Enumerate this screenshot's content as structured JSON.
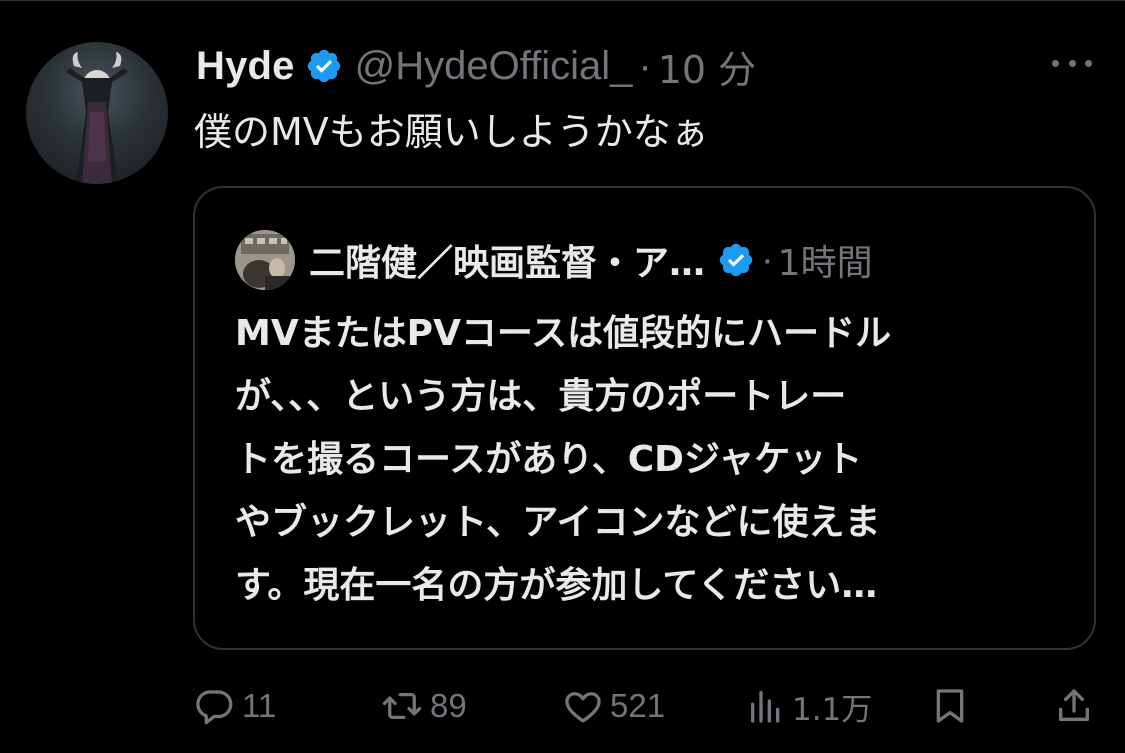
{
  "tweet": {
    "author": {
      "display_name": "Hyde",
      "handle": "@HydeOfficial_",
      "verified": true,
      "verified_color": "#1d9bf0"
    },
    "separator": "·",
    "time": "10 分",
    "text": "僕のMVもお願いしようかなぁ",
    "more_icon": "more-horizontal-icon"
  },
  "quoted_tweet": {
    "author": {
      "display_name": "二階健／映画監督・ア…",
      "verified": true
    },
    "separator": "·",
    "time": "1時間",
    "text_lines": [
      "MVまたはPVコースは値段的にハードル",
      "が、、、という方は、貴方のポートレー",
      "トを撮るコースがあり、CDジャケット",
      "やブックレット、アイコンなどに使えま",
      "す。現在一名の方が参加してください…"
    ]
  },
  "actions": {
    "reply": {
      "icon": "reply-icon",
      "count": "11"
    },
    "retweet": {
      "icon": "retweet-icon",
      "count": "89"
    },
    "like": {
      "icon": "heart-icon",
      "count": "521"
    },
    "views": {
      "icon": "views-icon",
      "count": "1.1万"
    },
    "bookmark": {
      "icon": "bookmark-icon"
    },
    "share": {
      "icon": "share-icon"
    }
  },
  "colors": {
    "background": "#000000",
    "text": "#e7e9ea",
    "muted": "#71767b",
    "border": "#2f3336",
    "accent": "#1d9bf0"
  }
}
